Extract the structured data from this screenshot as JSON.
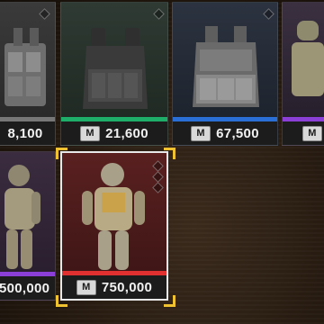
{
  "colors": {
    "green": "#1fae6a",
    "blue": "#2a6fd6",
    "purple": "#8b3fd6",
    "red": "#e03030",
    "selection": "#f0c232"
  },
  "currency_icon": "M",
  "items": [
    {
      "id": "armor-vest-1",
      "price": "8,100",
      "rarity": "common"
    },
    {
      "id": "armor-vest-2",
      "price": "21,600",
      "rarity": "uncommon"
    },
    {
      "id": "armor-vest-3",
      "price": "67,500",
      "rarity": "rare"
    },
    {
      "id": "armor-vest-4",
      "price": "",
      "rarity": "epic"
    },
    {
      "id": "armor-suit-1",
      "price": "500,000",
      "rarity": "epic"
    },
    {
      "id": "armor-suit-2",
      "price": "750,000",
      "rarity": "legendary",
      "selected": true
    }
  ]
}
